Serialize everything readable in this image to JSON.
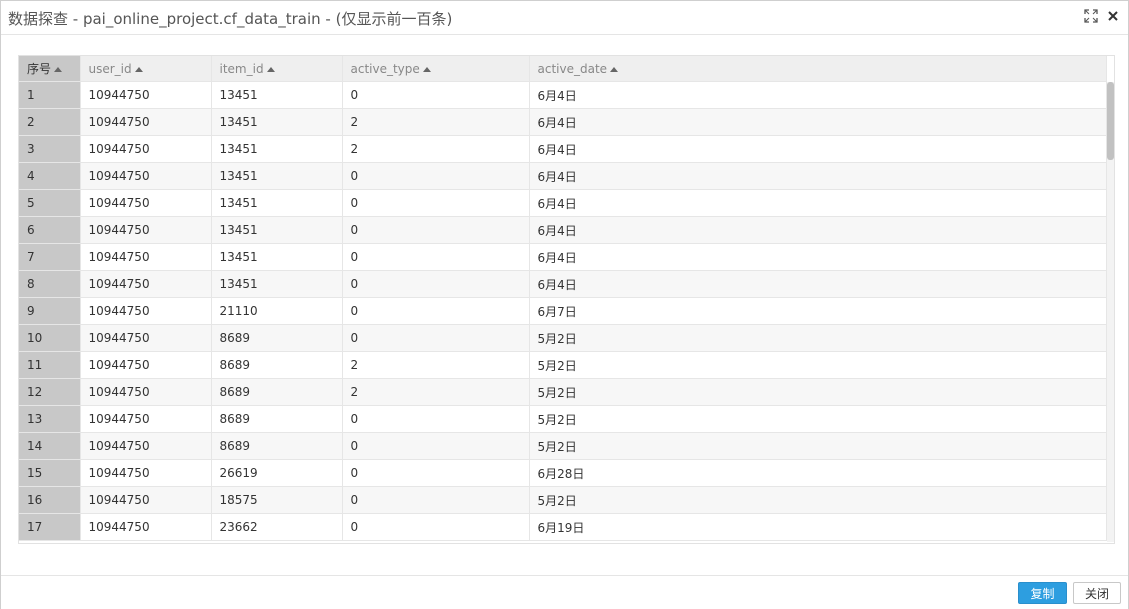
{
  "window": {
    "title": "数据探查 - pai_online_project.cf_data_train - (仅显示前一百条)",
    "icons": [
      "fullscreen-icon",
      "close-icon"
    ]
  },
  "table": {
    "columns": [
      "序号",
      "user_id",
      "item_id",
      "active_type",
      "active_date"
    ],
    "rows": [
      [
        "1",
        "10944750",
        "13451",
        "0",
        "6月4日"
      ],
      [
        "2",
        "10944750",
        "13451",
        "2",
        "6月4日"
      ],
      [
        "3",
        "10944750",
        "13451",
        "2",
        "6月4日"
      ],
      [
        "4",
        "10944750",
        "13451",
        "0",
        "6月4日"
      ],
      [
        "5",
        "10944750",
        "13451",
        "0",
        "6月4日"
      ],
      [
        "6",
        "10944750",
        "13451",
        "0",
        "6月4日"
      ],
      [
        "7",
        "10944750",
        "13451",
        "0",
        "6月4日"
      ],
      [
        "8",
        "10944750",
        "13451",
        "0",
        "6月4日"
      ],
      [
        "9",
        "10944750",
        "21110",
        "0",
        "6月7日"
      ],
      [
        "10",
        "10944750",
        "8689",
        "0",
        "5月2日"
      ],
      [
        "11",
        "10944750",
        "8689",
        "2",
        "5月2日"
      ],
      [
        "12",
        "10944750",
        "8689",
        "2",
        "5月2日"
      ],
      [
        "13",
        "10944750",
        "8689",
        "0",
        "5月2日"
      ],
      [
        "14",
        "10944750",
        "8689",
        "0",
        "5月2日"
      ],
      [
        "15",
        "10944750",
        "26619",
        "0",
        "6月28日"
      ],
      [
        "16",
        "10944750",
        "18575",
        "0",
        "5月2日"
      ],
      [
        "17",
        "10944750",
        "23662",
        "0",
        "6月19日"
      ]
    ]
  },
  "footer": {
    "copy_label": "复制",
    "close_label": "关闭"
  },
  "colors": {
    "primary_button": "#2d9ee0",
    "index_column": "#c8c8c8"
  }
}
